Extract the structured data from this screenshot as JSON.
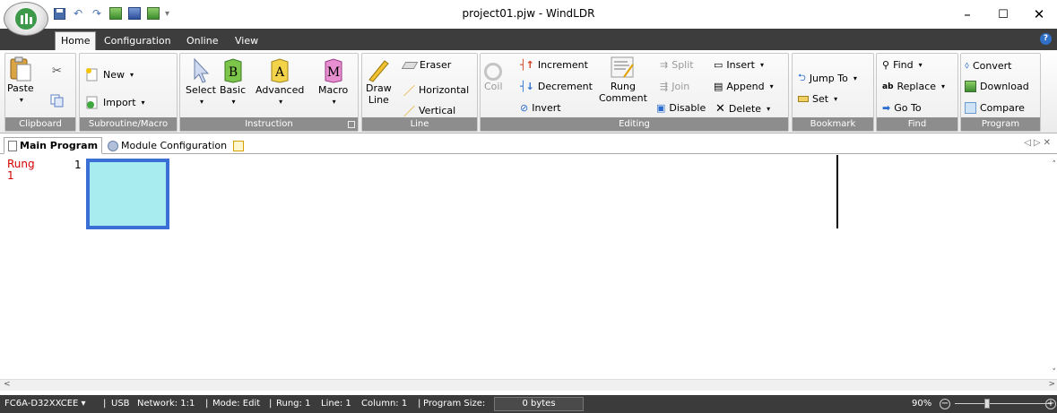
{
  "window": {
    "title": "project01.pjw - WindLDR",
    "controls": {
      "minimize": "–",
      "maximize": "☐",
      "close": "✕"
    }
  },
  "quick_access": {
    "dropdown": "▾"
  },
  "ribbon_tabs": {
    "home": "Home",
    "configuration": "Configuration",
    "online": "Online",
    "view": "View"
  },
  "groups": {
    "clipboard": {
      "caption": "Clipboard",
      "paste": "Paste"
    },
    "subroutine": {
      "caption": "Subroutine/Macro",
      "new": "New",
      "import": "Import"
    },
    "instruction": {
      "caption": "Instruction",
      "select": "Select",
      "basic": "Basic",
      "advanced": "Advanced",
      "macro": "Macro",
      "basic_glyph": "B",
      "advanced_glyph": "A",
      "macro_glyph": "M"
    },
    "line": {
      "caption": "Line",
      "draw_line_1": "Draw",
      "draw_line_2": "Line",
      "eraser": "Eraser",
      "horizontal": "Horizontal",
      "vertical": "Vertical"
    },
    "editing": {
      "caption": "Editing",
      "coil": "Coil",
      "increment": "Increment",
      "decrement": "Decrement",
      "invert": "Invert",
      "rung_comment_1": "Rung",
      "rung_comment_2": "Comment",
      "split": "Split",
      "join": "Join",
      "disable": "Disable",
      "insert": "Insert",
      "append": "Append",
      "delete": "Delete"
    },
    "bookmark": {
      "caption": "Bookmark",
      "jump_to": "Jump To",
      "set": "Set"
    },
    "find": {
      "caption": "Find",
      "find": "Find",
      "replace": "Replace",
      "go_to": "Go To"
    },
    "program": {
      "caption": "Program",
      "convert": "Convert",
      "download": "Download",
      "compare": "Compare"
    }
  },
  "doc_tabs": {
    "main_program": "Main Program",
    "module_configuration": "Module Configuration"
  },
  "editor": {
    "rung_label": "Rung",
    "rung_label_num": "1",
    "rung_number": "1"
  },
  "status": {
    "plc_model": "FC6A-D32XXCEE",
    "connection": "USB",
    "network": "Network: 1:1",
    "mode": "Mode: Edit",
    "rung": "Rung: 1",
    "line": "Line: 1",
    "column": "Column: 1",
    "program_size_label": "Program Size:",
    "program_size_value": "0 bytes",
    "zoom": "90%"
  },
  "colors": {
    "ribbon_tab_bar": "#3d3d3d",
    "caption_bar": "#8d8d8d",
    "status_bar": "#3b3b3b",
    "rung_label": "#d40000",
    "cursor_border": "#3a6fd6",
    "cursor_fill": "#a8ecef"
  }
}
